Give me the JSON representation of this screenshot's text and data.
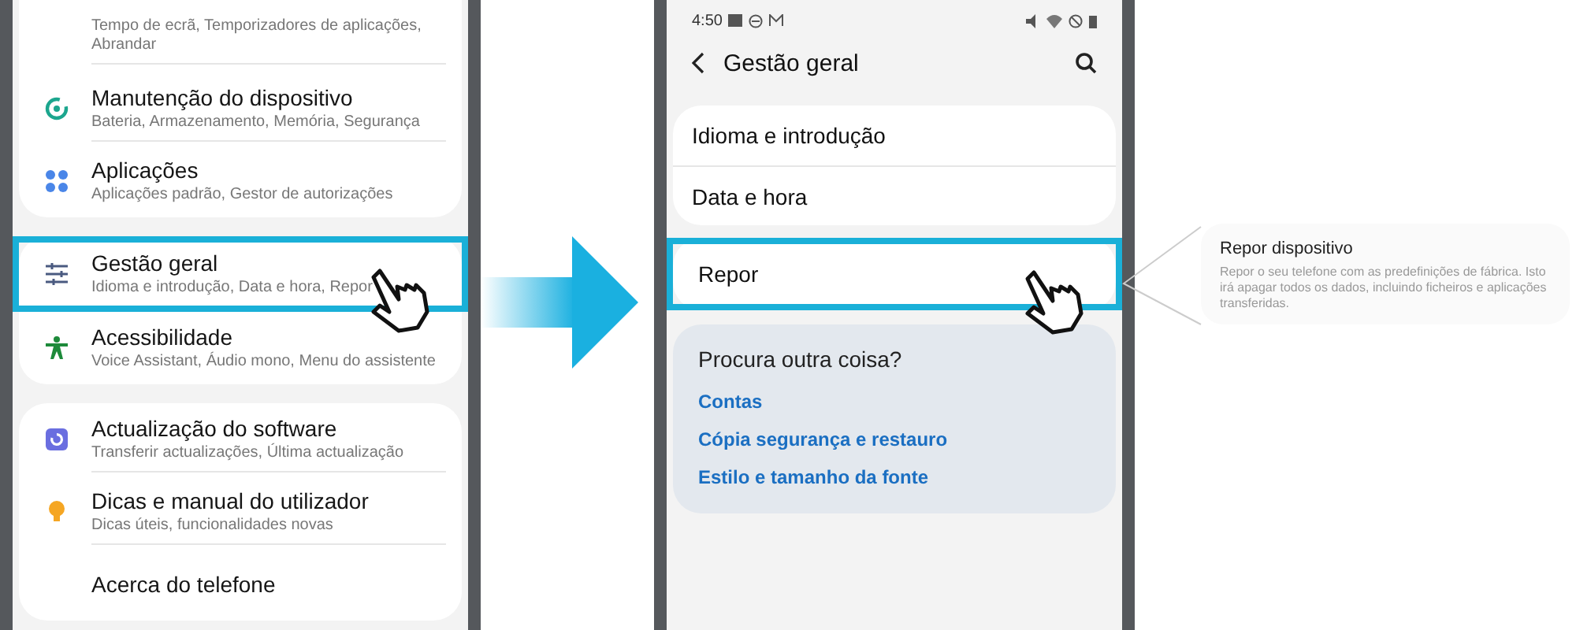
{
  "left_screen": {
    "cards": [
      {
        "items": [
          {
            "subtitle": "Tempo de ecrã, Temporizadores de aplicações, Abrandar",
            "highlighted": false
          },
          {
            "title": "Manutenção do dispositivo",
            "subtitle": "Bateria, Armazenamento, Memória, Segurança",
            "highlighted": false
          },
          {
            "title": "Aplicações",
            "subtitle": "Aplicações padrão, Gestor de autorizações",
            "highlighted": false
          }
        ]
      },
      {
        "items": [
          {
            "title": "Gestão geral",
            "subtitle": "Idioma e introdução, Data e hora, Repor",
            "highlighted": true
          },
          {
            "title": "Acessibilidade",
            "subtitle": "Voice Assistant, Áudio mono, Menu do assistente",
            "highlighted": false
          }
        ]
      },
      {
        "items": [
          {
            "title": "Actualização do software",
            "subtitle": "Transferir actualizações, Última actualização",
            "highlighted": false
          },
          {
            "title": "Dicas e manual do utilizador",
            "subtitle": "Dicas úteis, funcionalidades novas",
            "highlighted": false
          },
          {
            "title": "Acerca do telefone",
            "highlighted": false
          }
        ]
      }
    ]
  },
  "right_screen": {
    "status_bar": {
      "time": "4:50"
    },
    "header": {
      "title": "Gestão geral"
    },
    "cards": [
      {
        "items": [
          {
            "label": "Idioma e introdução",
            "highlighted": false
          },
          {
            "label": "Data e hora",
            "highlighted": false
          }
        ]
      },
      {
        "items": [
          {
            "label": "Repor",
            "highlighted": true
          }
        ]
      }
    ],
    "suggestions": {
      "title": "Procura outra coisa?",
      "links": [
        "Contas",
        "Cópia segurança e restauro",
        "Estilo e tamanho da fonte"
      ]
    }
  },
  "tooltip": {
    "title": "Repor dispositivo",
    "text": "Repor o seu telefone com as predefinições de fábrica. Isto irá apagar todos os dados, incluindo ficheiros e aplicações transferidas."
  }
}
